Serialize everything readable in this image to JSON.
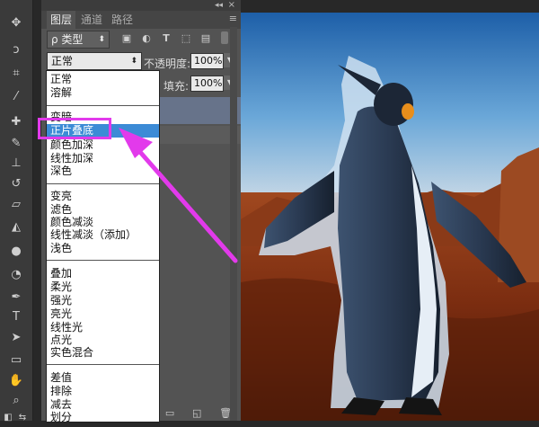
{
  "panel": {
    "collapse_glyph": "◂◂",
    "close_glyph": "×",
    "tabs": [
      {
        "label": "图层"
      },
      {
        "label": "通道"
      },
      {
        "label": "路径"
      }
    ],
    "menu_glyph": "≡",
    "filter": {
      "label": "ρ 类型",
      "chevron": "⬍"
    },
    "blend_mode": {
      "value": "正常",
      "chevron": "⬍"
    },
    "opacity": {
      "label": "不透明度:",
      "value": "100%",
      "drop": "▼"
    },
    "fill": {
      "label": "填充:",
      "value": "100%",
      "drop": "▼"
    }
  },
  "blend_menu": {
    "groups": [
      [
        "正常",
        "溶解"
      ],
      [
        "变暗",
        "正片叠底",
        "颜色加深",
        "线性加深",
        "深色"
      ],
      [
        "变亮",
        "滤色",
        "颜色减淡",
        "线性减淡（添加）",
        "浅色"
      ],
      [
        "叠加",
        "柔光",
        "强光",
        "亮光",
        "线性光",
        "点光",
        "实色混合"
      ],
      [
        "差值",
        "排除",
        "减去",
        "划分"
      ]
    ],
    "selected": "正片叠底"
  },
  "colors": {
    "highlight": "#e23aeb",
    "selection": "#3c8bd6",
    "panel_bg": "#535353",
    "toolbar_bg": "#3a3a3a"
  }
}
